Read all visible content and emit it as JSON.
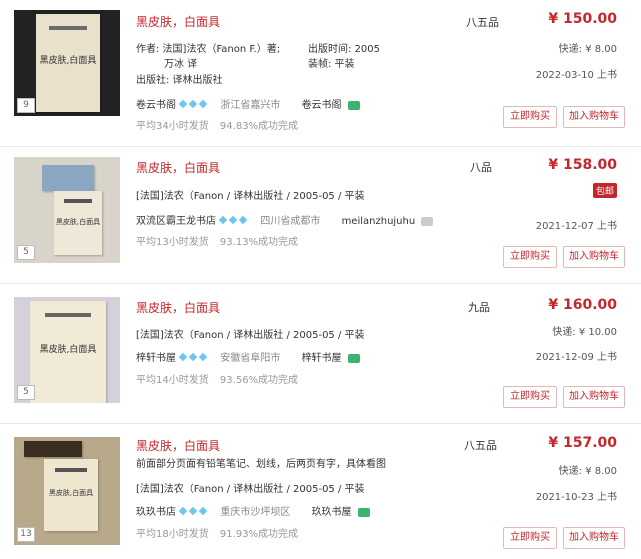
{
  "listings": [
    {
      "thumb_num": "9",
      "title": "黑皮肤，白面具",
      "condition": "八五品",
      "price": "¥ 150.00",
      "author_line1": "作者: 法国]法农（Fanon F.）著;",
      "author_line2": "万冰 译",
      "pub_time": "出版时间: 2005",
      "binding": "装帧: 平装",
      "publisher": "出版社: 译林出版社",
      "shipping": "快递: ¥ 8.00",
      "date": "2022-03-10 上书",
      "shop_name": "卷云书阁",
      "location": "浙江省嘉兴市",
      "seller": "卷云书阁",
      "stats_time": "平均34小时发货",
      "stats_rate": "94.83%成功完成",
      "buy_label": "立即购买",
      "cart_label": "加入购物车"
    },
    {
      "thumb_num": "5",
      "title": "黑皮肤，白面具",
      "condition": "八品",
      "price": "¥ 158.00",
      "pub_line": "[法国]法农（Fanon  / 译林出版社 / 2005-05 / 平装",
      "badge": "包邮",
      "date": "2021-12-07 上书",
      "shop_name": "双流区霸王龙书店",
      "location": "四川省成都市",
      "seller": "meilanzhujuhu",
      "stats_time": "平均13小时发货",
      "stats_rate": "93.13%成功完成",
      "buy_label": "立即购买",
      "cart_label": "加入购物车"
    },
    {
      "thumb_num": "5",
      "title": "黑皮肤，白面具",
      "condition": "九品",
      "price": "¥ 160.00",
      "pub_line": "[法国]法农（Fanon  / 译林出版社 / 2005-05 / 平装",
      "shipping": "快递: ¥ 10.00",
      "date": "2021-12-09 上书",
      "shop_name": "梓轩书屋",
      "location": "安徽省阜阳市",
      "seller": "梓轩书屋",
      "stats_time": "平均14小时发货",
      "stats_rate": "93.56%成功完成",
      "buy_label": "立即购买",
      "cart_label": "加入购物车"
    },
    {
      "thumb_num": "13",
      "title": "黑皮肤，白面具",
      "condition": "八五品",
      "price": "¥ 157.00",
      "note": "前面部分页面有铅笔笔记、划线，后两页有字，具体看图",
      "pub_line": "[法国]法农（Fanon  / 译林出版社 / 2005-05 / 平装",
      "shipping": "快递: ¥ 8.00",
      "date": "2021-10-23 上书",
      "shop_name": "玖玖书店",
      "location": "重庆市沙坪坝区",
      "seller": "玖玖书屋",
      "stats_time": "平均18小时发货",
      "stats_rate": "91.93%成功完成",
      "buy_label": "立即购买",
      "cart_label": "加入购物车"
    }
  ],
  "book_cover_text": "黑皮肤,白面具",
  "colors": {
    "accent": "#c3272b",
    "gem": "#6ec6f0",
    "chat_online": "#3cb371"
  }
}
